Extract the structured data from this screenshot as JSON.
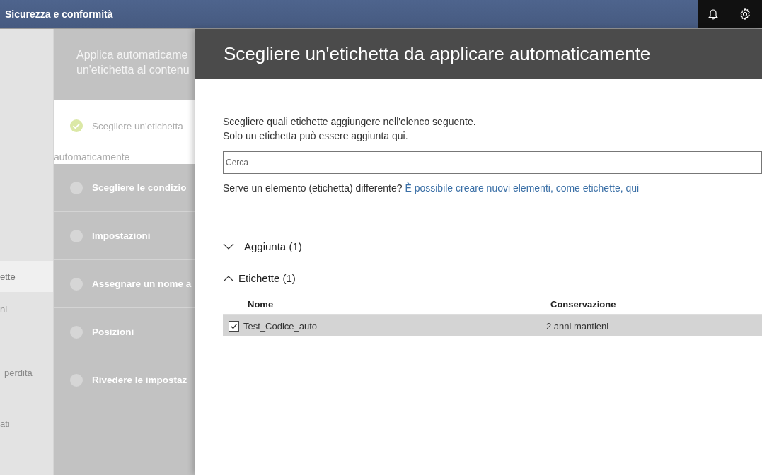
{
  "topbar": {
    "title": "Sicurezza e conformità"
  },
  "nav": {
    "items": [
      {
        "label": "ette",
        "selected": true
      },
      {
        "label": "ni",
        "selected": false
      },
      {
        "label": "perdita",
        "selected": false
      },
      {
        "label": "ati",
        "selected": false
      }
    ]
  },
  "wizard": {
    "intro": [
      "Applica automaticame",
      "un'etichetta al contenu"
    ],
    "steps": [
      {
        "label": "Scegliere un'etichetta",
        "continuation": "automaticamente",
        "completed": true,
        "selected": true
      },
      {
        "label": "Scegliere le condizio",
        "completed": false,
        "selected": false
      },
      {
        "label": "Impostazioni",
        "completed": false,
        "selected": false
      },
      {
        "label": "Assegnare un nome a",
        "completed": false,
        "selected": false
      },
      {
        "label": "Posizioni",
        "completed": false,
        "selected": false
      },
      {
        "label": "Rivedere le impostaz",
        "completed": false,
        "selected": false
      }
    ]
  },
  "panel": {
    "title": "Scegliere un'etichetta da applicare automaticamente",
    "instructions": [
      "Scegliere quali etichette aggiungere nell'elenco seguente.",
      "Solo un etichetta può essere aggiunta qui."
    ],
    "search": {
      "placeholder": "Cerca"
    },
    "help": {
      "text": "Serve un elemento (etichetta) differente?",
      "link": "È possibile creare nuovi elementi, come etichette, qui"
    },
    "groups": [
      {
        "label": "Aggiunta (1)",
        "expanded": false
      },
      {
        "label": "Etichette (1)",
        "expanded": true,
        "columns": [
          "Nome",
          "Conservazione"
        ],
        "rows": [
          {
            "name": "Test_Codice_auto",
            "retention": "2 anni mantieni",
            "checked": true,
            "selected": true
          }
        ]
      }
    ]
  }
}
